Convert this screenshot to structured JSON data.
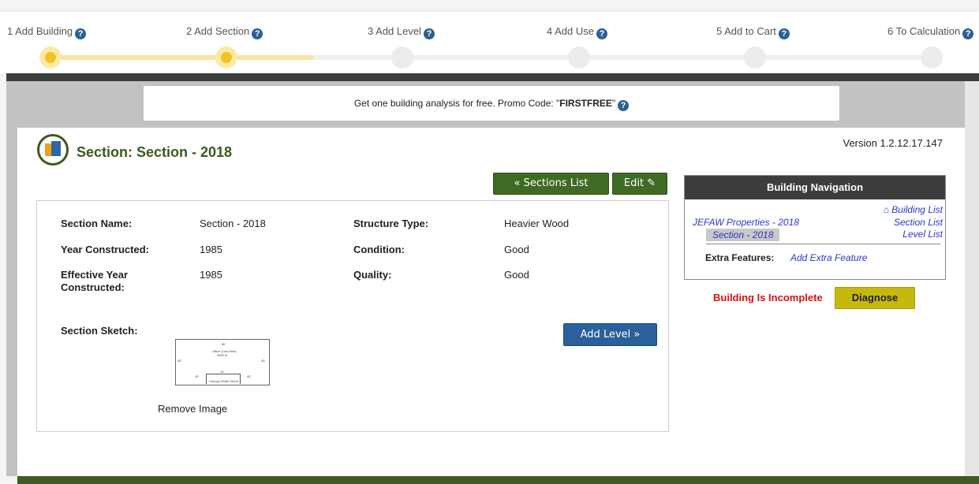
{
  "wizard": {
    "steps": [
      {
        "label": "1 Add Building"
      },
      {
        "label": "2 Add Section"
      },
      {
        "label": "3 Add Level"
      },
      {
        "label": "4 Add Use"
      },
      {
        "label": "5 Add to Cart"
      },
      {
        "label": "6 To Calculation"
      }
    ],
    "current_step": 2,
    "help_glyph": "?"
  },
  "promo": {
    "text": "Get one building analysis for free. Promo Code: \"",
    "code": "FIRSTFREE",
    "suffix": "\""
  },
  "header": {
    "title": "Section: Section - 2018",
    "version": "Version 1.2.12.17.147"
  },
  "toolbar": {
    "sections_list": "« Sections List",
    "edit": "Edit ✎"
  },
  "section": {
    "name_label": "Section Name:",
    "name": "Section - 2018",
    "structure_label": "Structure Type:",
    "structure": "Heavier Wood",
    "year_label": "Year Constructed:",
    "year": "1985",
    "condition_label": "Condition:",
    "condition": "Good",
    "eff_label_1": "Effective Year",
    "eff_label_2": "Constructed:",
    "eff_year": "1985",
    "quality_label": "Quality:",
    "quality": "Good",
    "sketch_label": "Section Sketch:",
    "remove_image": "Remove Image",
    "add_level": "Add Level »"
  },
  "navigation": {
    "heading": "Building Navigation",
    "building_list": "Building List",
    "property": "JEFAW Properties - 2018",
    "section_list": "Section List",
    "section": "Section - 2018",
    "level_list": "Level List",
    "extra_label": "Extra Features:",
    "extra_link": "Add Extra Feature"
  },
  "status": {
    "message": "Building Is Incomplete",
    "diagnose": "Diagnose"
  },
  "colors": {
    "active_step": "#f2c21f",
    "brand_green": "#3f6a23",
    "brand_blue": "#2a609b",
    "alert_red": "#d01414",
    "diagnose_yellow": "#c7b80e"
  }
}
